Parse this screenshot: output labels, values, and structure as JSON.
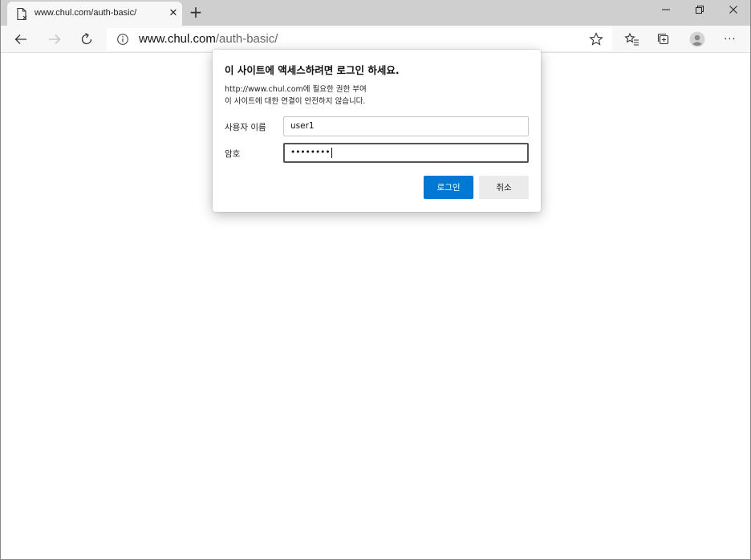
{
  "tab": {
    "title": "www.chul.com/auth-basic/",
    "close_glyph": "✕",
    "new_tab_glyph": "+"
  },
  "window_controls": {
    "minimize": "–",
    "restore": "❐",
    "close": "✕"
  },
  "toolbar": {
    "more_glyph": "···"
  },
  "address": {
    "host": "www.chul.com",
    "path": "/auth-basic/"
  },
  "dialog": {
    "title": "이 사이트에 액세스하려면 로그인 하세요.",
    "message_line1": "http://www.chul.com에 필요한 권한 부여",
    "message_line2": "이 사이트에 대한 연결이 안전하지 않습니다.",
    "username_label": "사용자 이름",
    "username_value": "user1",
    "password_label": "암호",
    "password_value": "••••••••",
    "login_label": "로그인",
    "cancel_label": "취소"
  },
  "colors": {
    "accent": "#0078d4",
    "tabstrip": "#cfcfcf",
    "toolbar": "#f7f7f7"
  },
  "icons": [
    "page-icon",
    "back-icon",
    "forward-icon",
    "refresh-icon",
    "info-icon",
    "star-icon",
    "favorites-icon",
    "collections-icon",
    "profile-icon",
    "more-icon"
  ]
}
